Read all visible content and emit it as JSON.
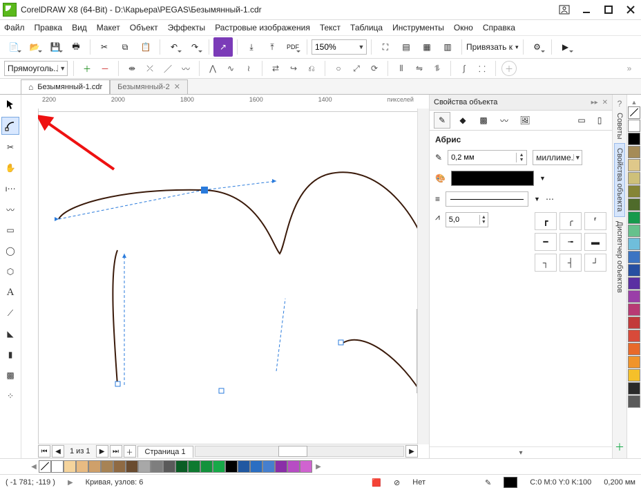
{
  "titlebar": {
    "text": "CorelDRAW X8 (64-Bit) - D:\\Карьера\\PEGAS\\Безымянный-1.cdr"
  },
  "menu": {
    "file": "Файл",
    "edit": "Правка",
    "view": "Вид",
    "layout": "Макет",
    "object": "Объект",
    "effects": "Эффекты",
    "bitmaps": "Растровые изображения",
    "text": "Текст",
    "table": "Таблица",
    "tools": "Инструменты",
    "window": "Окно",
    "help": "Справка"
  },
  "toolbar_main": {
    "zoom": "150%",
    "bind_label": "Привязать к"
  },
  "propbar": {
    "mode": "Прямоуголь..."
  },
  "docs": {
    "tab1": "Безымянный-1.cdr",
    "tab2": "Безымянный-2"
  },
  "ruler_h": {
    "t1": "2200",
    "t2": "2000",
    "t3": "1800",
    "t4": "1600",
    "t5": "1400",
    "unit": "пикселей"
  },
  "page_nav": {
    "page_of": "1  из  1",
    "page_label": "Страница 1"
  },
  "status": {
    "coords": "( -1 781; -119  )",
    "curve": "Кривая, узлов: 6",
    "fill": "Нет",
    "cmyk": "C:0 M:0 Y:0 K:100",
    "outline": "0,200 мм"
  },
  "props": {
    "title": "Свойства объекта",
    "section": "Абрис",
    "width_value": "0,2 мм",
    "units": "миллиме...",
    "miter": "5,0"
  },
  "dock": {
    "hints": "Советы",
    "props": "Свойства объекта",
    "objmgr": "Диспетчер объектов"
  },
  "palette_bottom": [
    "#ffffff",
    "#f5d49c",
    "#e8bb82",
    "#cfa06a",
    "#a78355",
    "#8f6a43",
    "#6a4c30",
    "#a8a8a8",
    "#7e7e7e",
    "#5a5a5a",
    "#0b5d25",
    "#0e7a30",
    "#13923c",
    "#17a948",
    "#000000",
    "#2158a1",
    "#2a6ec2",
    "#467fce",
    "#8a2ea8",
    "#b74cc4",
    "#d063d0"
  ],
  "color_column": [
    "#ffffff",
    "#000000",
    "#a58b57",
    "#dfc88a",
    "#cec07a",
    "#858536",
    "#4f6b2b",
    "#169a4c",
    "#66c18c",
    "#6fbedb",
    "#3c74c2",
    "#264fa1",
    "#5a2fa2",
    "#9a3fa8",
    "#b83a74",
    "#c23a3a",
    "#d84a3a",
    "#e86a2a",
    "#f0942a",
    "#f5c02a",
    "#2a2a2a",
    "#5a5a5a"
  ]
}
